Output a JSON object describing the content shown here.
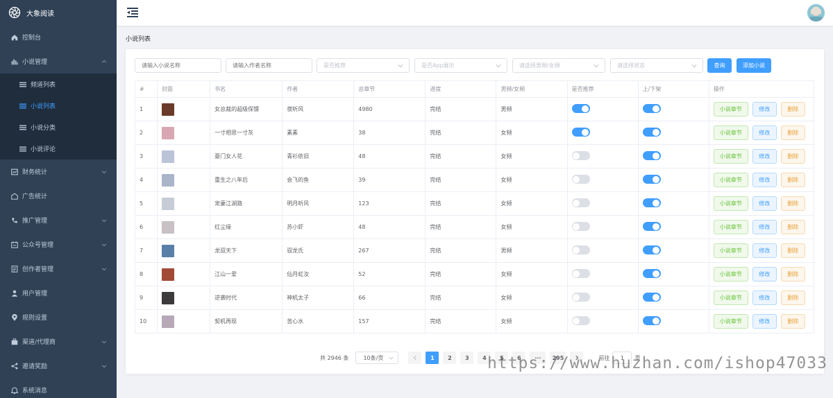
{
  "brand": {
    "name": "大象阅读"
  },
  "sidebar": {
    "items": [
      {
        "label": "控制台",
        "icon": "home-icon",
        "has_children": false
      },
      {
        "label": "小说管理",
        "icon": "bar-chart-icon",
        "has_children": true,
        "expanded": true,
        "children": [
          {
            "label": "频道列表",
            "active": false
          },
          {
            "label": "小说列表",
            "active": true
          },
          {
            "label": "小说分类",
            "active": false
          },
          {
            "label": "小说评论",
            "active": false
          }
        ]
      },
      {
        "label": "财务统计",
        "icon": "finance-icon",
        "has_children": true
      },
      {
        "label": "广告统计",
        "icon": "ad-icon",
        "has_children": false
      },
      {
        "label": "推广管理",
        "icon": "phone-icon",
        "has_children": true
      },
      {
        "label": "公众号管理",
        "icon": "calendar-icon",
        "has_children": true
      },
      {
        "label": "创作者管理",
        "icon": "document-icon",
        "has_children": true
      },
      {
        "label": "用户管理",
        "icon": "user-icon",
        "has_children": false
      },
      {
        "label": "规则设置",
        "icon": "location-icon",
        "has_children": false
      },
      {
        "label": "渠道/代理商",
        "icon": "cooperation-icon",
        "has_children": true
      },
      {
        "label": "邀请奖励",
        "icon": "share-icon",
        "has_children": true
      },
      {
        "label": "系统消息",
        "icon": "bell-icon",
        "has_children": false
      }
    ]
  },
  "breadcrumb": "小说列表",
  "filters": {
    "novel_name_placeholder": "请输入小说名称",
    "author_placeholder": "请输入作者名称",
    "recommend_placeholder": "是否推荐",
    "app_show_placeholder": "是否App展示",
    "gender_placeholder": "请选择男频/女频",
    "status_placeholder": "请选择状态",
    "search_label": "查询",
    "add_label": "添加小说"
  },
  "table": {
    "headers": [
      "#",
      "封面",
      "书名",
      "作者",
      "总章节",
      "进度",
      "男频/女频",
      "是否推荐",
      "上/下架",
      "操作"
    ],
    "rows": [
      {
        "idx": "1",
        "title": "女总裁的超级保镖",
        "author": "夜听风",
        "chapters": "4980",
        "progress": "完结",
        "gender": "男频",
        "recommend": true,
        "online": true,
        "cover": "#6b3a2a"
      },
      {
        "idx": "2",
        "title": "一寸相思一寸灰",
        "author": "素素",
        "chapters": "38",
        "progress": "完结",
        "gender": "女频",
        "recommend": true,
        "online": true,
        "cover": "#d9a7b3"
      },
      {
        "idx": "3",
        "title": "豪门女人花",
        "author": "青衫依旧",
        "chapters": "48",
        "progress": "完结",
        "gender": "女频",
        "recommend": false,
        "online": true,
        "cover": "#b9c4d8"
      },
      {
        "idx": "4",
        "title": "重生之八年后",
        "author": "会飞的鱼",
        "chapters": "39",
        "progress": "完结",
        "gender": "女频",
        "recommend": false,
        "online": true,
        "cover": "#a9b6c9"
      },
      {
        "idx": "5",
        "title": "宠妻江湖路",
        "author": "明月听风",
        "chapters": "123",
        "progress": "完结",
        "gender": "女频",
        "recommend": false,
        "online": true,
        "cover": "#c7ccd6"
      },
      {
        "idx": "6",
        "title": "红尘缘",
        "author": "苏小虾",
        "chapters": "48",
        "progress": "完结",
        "gender": "女频",
        "recommend": false,
        "online": true,
        "cover": "#c9c1c6"
      },
      {
        "idx": "7",
        "title": "龙驭天下",
        "author": "驭龙氏",
        "chapters": "267",
        "progress": "完结",
        "gender": "男频",
        "recommend": false,
        "online": true,
        "cover": "#5a7fa8"
      },
      {
        "idx": "8",
        "title": "江山一爱",
        "author": "仙月虹汝",
        "chapters": "52",
        "progress": "完结",
        "gender": "女频",
        "recommend": false,
        "online": true,
        "cover": "#a24a35"
      },
      {
        "idx": "9",
        "title": "逆袭时代",
        "author": "神机太子",
        "chapters": "66",
        "progress": "完结",
        "gender": "女频",
        "recommend": false,
        "online": true,
        "cover": "#3d3a3c"
      },
      {
        "idx": "10",
        "title": "契机再现",
        "author": "苦心水",
        "chapters": "157",
        "progress": "完结",
        "gender": "女频",
        "recommend": false,
        "online": true,
        "cover": "#b7a9b8"
      }
    ],
    "actions": {
      "chapters": "小说章节",
      "edit": "修改",
      "delete": "删除"
    }
  },
  "pagination": {
    "total_text": "共 2946 条",
    "page_size": "10条/页",
    "pages": [
      "1",
      "2",
      "3",
      "4",
      "5",
      "6",
      "···",
      "295"
    ],
    "current": "1",
    "goto_label": "前往",
    "goto_value": "1",
    "page_suffix": "页"
  },
  "watermark": "https://www.huzhan.com/ishop47033",
  "colors": {
    "sidebar_bg": "#304156",
    "accent": "#409eff",
    "success": "#67c23a",
    "warning": "#e6a23c"
  }
}
